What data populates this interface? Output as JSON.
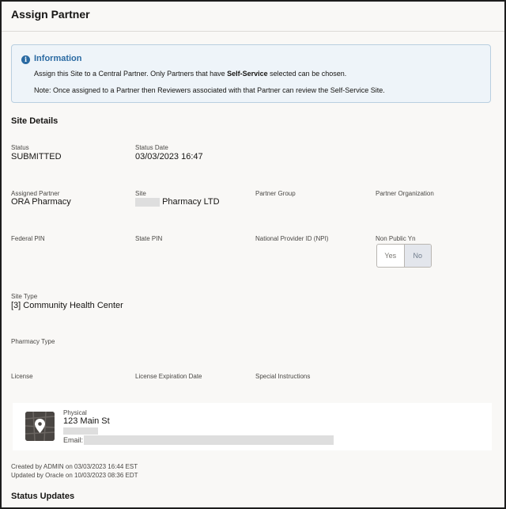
{
  "header": {
    "title": "Assign Partner"
  },
  "info": {
    "title": "Information",
    "line1_prefix": "Assign this Site to a Central Partner. Only Partners that have ",
    "line1_bold": "Self-Service",
    "line1_suffix": " selected can be chosen.",
    "line2": "Note: Once assigned to a Partner then Reviewers associated with that Partner can review the Self-Service Site."
  },
  "site_details": {
    "title": "Site Details",
    "status_label": "Status",
    "status_value": "SUBMITTED",
    "status_date_label": "Status Date",
    "status_date_value": "03/03/2023 16:47",
    "assigned_partner_label": "Assigned Partner",
    "assigned_partner_value": "ORA Pharmacy",
    "site_label": "Site",
    "site_value": "Pharmacy LTD",
    "partner_group_label": "Partner Group",
    "partner_org_label": "Partner Organization",
    "federal_pin_label": "Federal PIN",
    "state_pin_label": "State PIN",
    "npi_label": "National Provider ID (NPI)",
    "non_public_label": "Non Public Yn",
    "toggle_yes": "Yes",
    "toggle_no": "No",
    "toggle_selected": "No",
    "site_type_label": "Site Type",
    "site_type_value": "[3] Community Health Center",
    "pharmacy_type_label": "Pharmacy Type",
    "license_label": "License",
    "license_exp_label": "License Expiration Date",
    "special_instructions_label": "Special Instructions"
  },
  "address": {
    "type_label": "Physical",
    "street": "123 Main St",
    "email_label": "Email:",
    "icon": "map-pin-icon"
  },
  "meta": {
    "created": "Created by ADMIN on 03/03/2023 16:44 EST",
    "updated": "Updated by Oracle on 10/03/2023 08:36 EDT"
  },
  "status_updates": {
    "title": "Status Updates"
  },
  "colors": {
    "info_accent": "#2a6aa2",
    "info_background": "#eef4f9",
    "page_background": "#f9f8f6"
  }
}
